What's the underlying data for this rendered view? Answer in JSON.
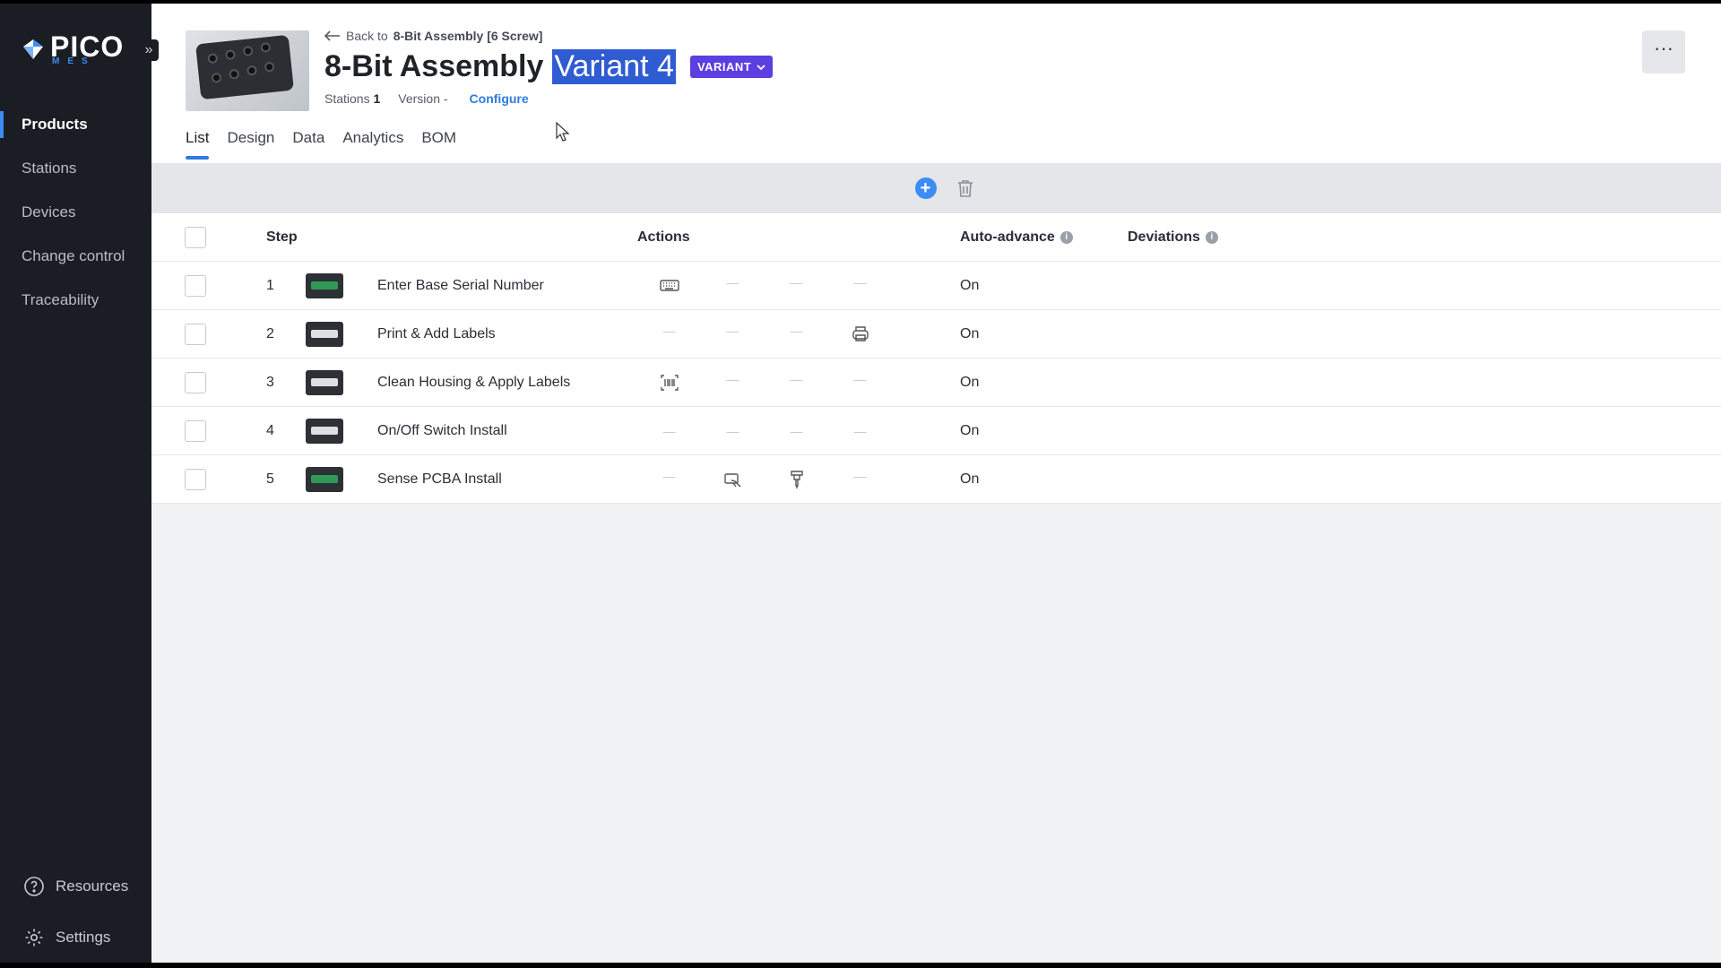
{
  "app": {
    "logo_word": "PICO",
    "logo_sub": "MES",
    "collapse_icon": "chevron-double-right-icon"
  },
  "sidebar": {
    "items": [
      {
        "label": "Products",
        "active": true
      },
      {
        "label": "Stations",
        "active": false
      },
      {
        "label": "Devices",
        "active": false
      },
      {
        "label": "Change control",
        "active": false
      },
      {
        "label": "Traceability",
        "active": false
      }
    ],
    "bottom": [
      {
        "label": "Resources",
        "icon": "help-circle-icon"
      },
      {
        "label": "Settings",
        "icon": "gear-icon"
      }
    ]
  },
  "header": {
    "back_prefix": "Back to",
    "back_target": "8-Bit Assembly [6 Screw]",
    "title_main": "8-Bit Assembly",
    "title_selected": "Variant 4",
    "badge": "VARIANT",
    "stations_label": "Stations",
    "stations_value": "1",
    "version_label": "Version",
    "version_value": "-",
    "configure_label": "Configure",
    "more_label": "···"
  },
  "tabs": [
    {
      "label": "List",
      "active": true
    },
    {
      "label": "Design",
      "active": false
    },
    {
      "label": "Data",
      "active": false
    },
    {
      "label": "Analytics",
      "active": false
    },
    {
      "label": "BOM",
      "active": false
    }
  ],
  "table": {
    "headers": {
      "step": "Step",
      "actions": "Actions",
      "auto_advance": "Auto-advance",
      "deviations": "Deviations"
    },
    "rows": [
      {
        "num": "1",
        "name": "Enter Base Serial Number",
        "actions": [
          "keyboard-icon",
          "—",
          "—",
          "—"
        ],
        "auto": "On",
        "thumb": "green"
      },
      {
        "num": "2",
        "name": "Print & Add Labels",
        "actions": [
          "—",
          "—",
          "—",
          "printer-icon"
        ],
        "auto": "On",
        "thumb": "dark"
      },
      {
        "num": "3",
        "name": "Clean Housing & Apply Labels",
        "actions": [
          "barcode-icon",
          "—",
          "—",
          "—"
        ],
        "auto": "On",
        "thumb": "dark"
      },
      {
        "num": "4",
        "name": "On/Off Switch Install",
        "actions": [
          "—",
          "—",
          "—",
          "—"
        ],
        "auto": "On",
        "thumb": "dark"
      },
      {
        "num": "5",
        "name": "Sense PCBA Install",
        "actions": [
          "—",
          "hand-scan-icon",
          "screwdriver-icon",
          "—"
        ],
        "auto": "On",
        "thumb": "green"
      }
    ]
  },
  "colors": {
    "sidebar_bg": "#1a1d24",
    "accent": "#3d8bf5",
    "badge": "#5b3fe0",
    "selection": "#2f5bd3"
  }
}
